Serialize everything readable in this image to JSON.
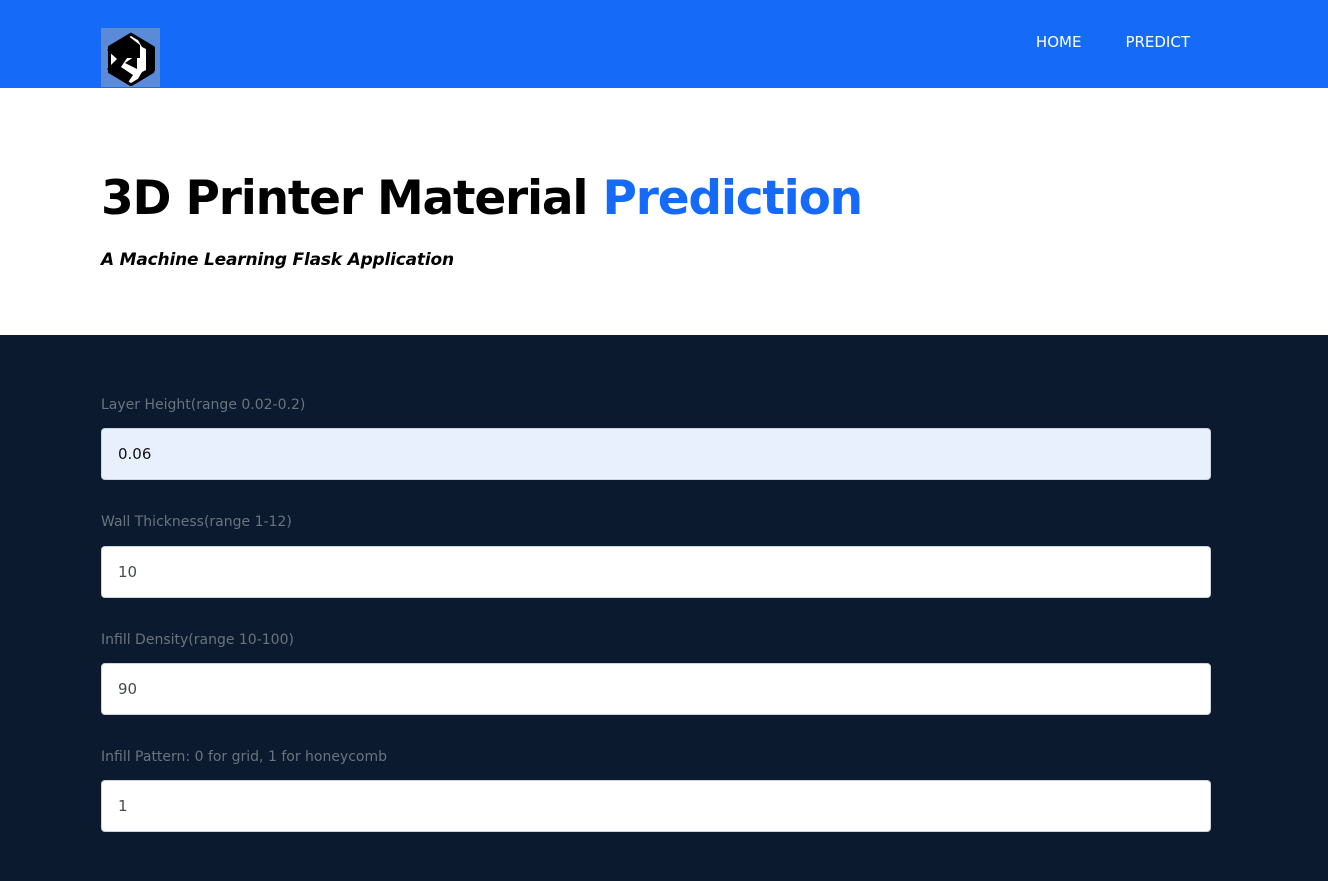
{
  "navbar": {
    "logo_icon": "unity-logo-icon",
    "links": [
      {
        "label": "HOME"
      },
      {
        "label": "PREDICT"
      }
    ],
    "background": "#156bf7"
  },
  "hero": {
    "title_main": "3D Printer Material",
    "title_accent": "Prediction",
    "subtitle": "A Machine Learning Flask Application",
    "accent_color": "#156bf7"
  },
  "form": {
    "background": "#0b1a2e",
    "fields": [
      {
        "label": "Layer Height(range 0.02-0.2)",
        "value": "0.06"
      },
      {
        "label": "Wall Thickness(range 1-12)",
        "value": "10"
      },
      {
        "label": "Infill Density(range 10-100)",
        "value": "90"
      },
      {
        "label": "Infill Pattern: 0 for grid, 1 for honeycomb",
        "value": "1"
      }
    ]
  }
}
